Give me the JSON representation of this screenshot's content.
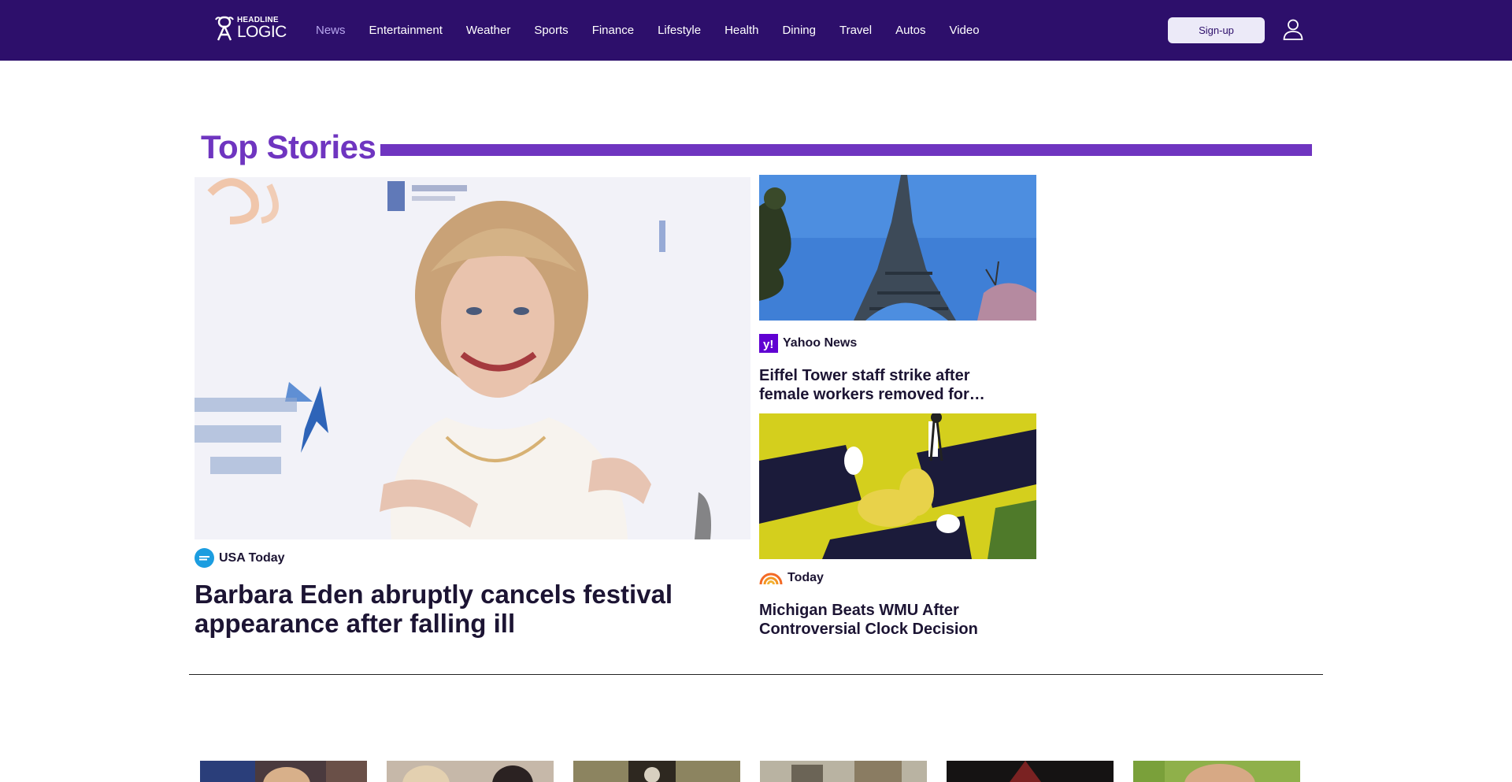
{
  "brand": {
    "line1": "HEADLINE",
    "line2": "LOGIC"
  },
  "nav": {
    "items": [
      {
        "label": "News",
        "active": true
      },
      {
        "label": "Entertainment"
      },
      {
        "label": "Weather"
      },
      {
        "label": "Sports"
      },
      {
        "label": "Finance"
      },
      {
        "label": "Lifestyle"
      },
      {
        "label": "Health"
      },
      {
        "label": "Dining"
      },
      {
        "label": "Travel"
      },
      {
        "label": "Autos"
      },
      {
        "label": "Video"
      }
    ],
    "signup_label": "Sign-up",
    "user_icon": "user-icon"
  },
  "colors": {
    "header_bg": "#2d0f6b",
    "accent": "#6f35c0",
    "active_nav": "#b7a6ee",
    "signup_bg": "#eceaf8"
  },
  "top_stories": {
    "heading": "Top Stories",
    "lead": {
      "source": "USA Today",
      "source_icon": "usa-today-logo-icon",
      "headline": "Barbara Eden abruptly cancels festival appearance after falling ill"
    },
    "side": [
      {
        "source": "Yahoo News",
        "source_icon": "yahoo-logo-icon",
        "headline": "Eiffel Tower staff strike after female workers removed for…"
      },
      {
        "source": "Today",
        "source_icon": "today-logo-icon",
        "headline": "Michigan Beats WMU After Controversial Clock Decision"
      }
    ]
  }
}
